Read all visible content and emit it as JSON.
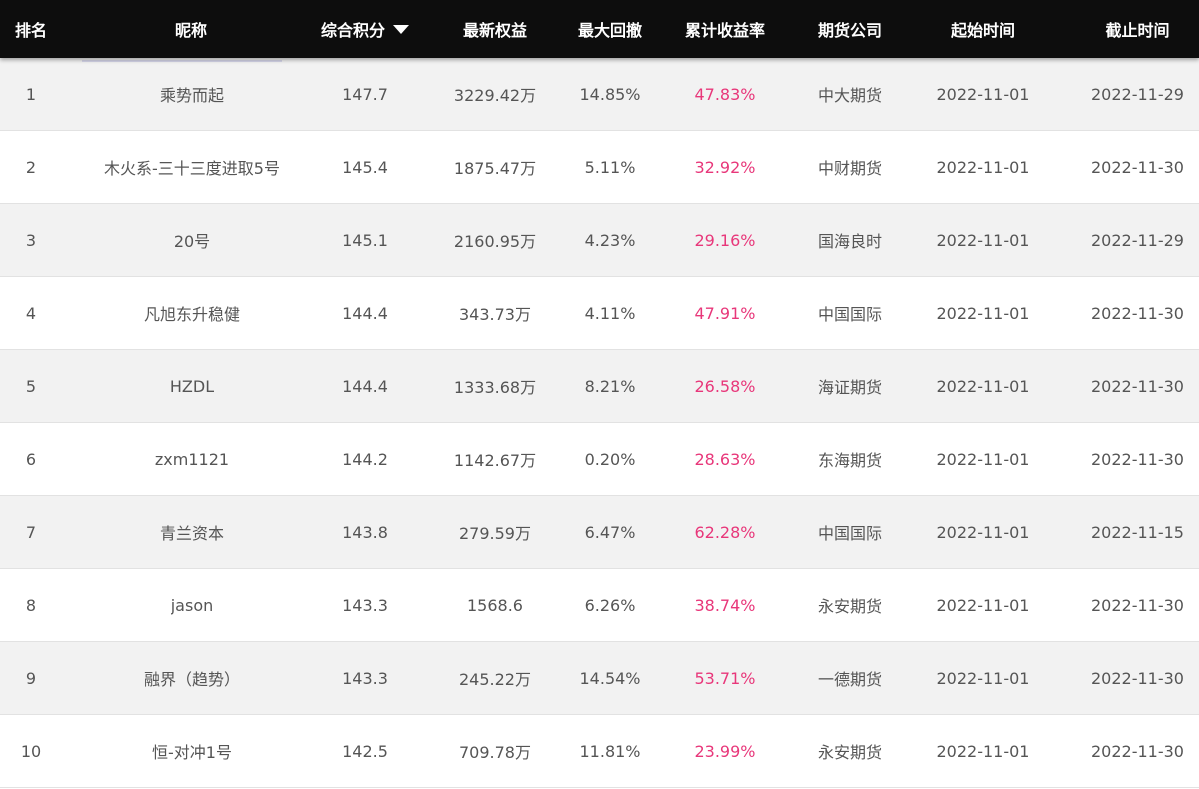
{
  "colors": {
    "header_bg": "#0d0d0d",
    "header_text": "#ffffff",
    "row_alt": "#f2f2f2",
    "return_text": "#e8377a"
  },
  "header": {
    "rank": "排名",
    "name": "昵称",
    "score": "综合积分",
    "equity": "最新权益",
    "drawdown": "最大回撤",
    "return": "累计收益率",
    "company": "期货公司",
    "start": "起始时间",
    "end": "截止时间",
    "sort_icon": "caret-down-icon"
  },
  "rows": [
    {
      "rank": "1",
      "name": "乘势而起",
      "score": "147.7",
      "equity": "3229.42万",
      "drawdown": "14.85%",
      "return": "47.83%",
      "company": "中大期货",
      "start": "2022-11-01",
      "end": "2022-11-29"
    },
    {
      "rank": "2",
      "name": "木火系-三十三度进取5号",
      "score": "145.4",
      "equity": "1875.47万",
      "drawdown": "5.11%",
      "return": "32.92%",
      "company": "中财期货",
      "start": "2022-11-01",
      "end": "2022-11-30"
    },
    {
      "rank": "3",
      "name": "20号",
      "score": "145.1",
      "equity": "2160.95万",
      "drawdown": "4.23%",
      "return": "29.16%",
      "company": "国海良时",
      "start": "2022-11-01",
      "end": "2022-11-29"
    },
    {
      "rank": "4",
      "name": "凡旭东升稳健",
      "score": "144.4",
      "equity": "343.73万",
      "drawdown": "4.11%",
      "return": "47.91%",
      "company": "中国国际",
      "start": "2022-11-01",
      "end": "2022-11-30"
    },
    {
      "rank": "5",
      "name": "HZDL",
      "score": "144.4",
      "equity": "1333.68万",
      "drawdown": "8.21%",
      "return": "26.58%",
      "company": "海证期货",
      "start": "2022-11-01",
      "end": "2022-11-30"
    },
    {
      "rank": "6",
      "name": "zxm1121",
      "score": "144.2",
      "equity": "1142.67万",
      "drawdown": "0.20%",
      "return": "28.63%",
      "company": "东海期货",
      "start": "2022-11-01",
      "end": "2022-11-30"
    },
    {
      "rank": "7",
      "name": "青兰资本",
      "score": "143.8",
      "equity": "279.59万",
      "drawdown": "6.47%",
      "return": "62.28%",
      "company": "中国国际",
      "start": "2022-11-01",
      "end": "2022-11-15"
    },
    {
      "rank": "8",
      "name": "jason",
      "score": "143.3",
      "equity": "1568.6",
      "drawdown": "6.26%",
      "return": "38.74%",
      "company": "永安期货",
      "start": "2022-11-01",
      "end": "2022-11-30"
    },
    {
      "rank": "9",
      "name": "融界（趋势）",
      "score": "143.3",
      "equity": "245.22万",
      "drawdown": "14.54%",
      "return": "53.71%",
      "company": "一德期货",
      "start": "2022-11-01",
      "end": "2022-11-30"
    },
    {
      "rank": "10",
      "name": "恒-对冲1号",
      "score": "142.5",
      "equity": "709.78万",
      "drawdown": "11.81%",
      "return": "23.99%",
      "company": "永安期货",
      "start": "2022-11-01",
      "end": "2022-11-30"
    }
  ]
}
